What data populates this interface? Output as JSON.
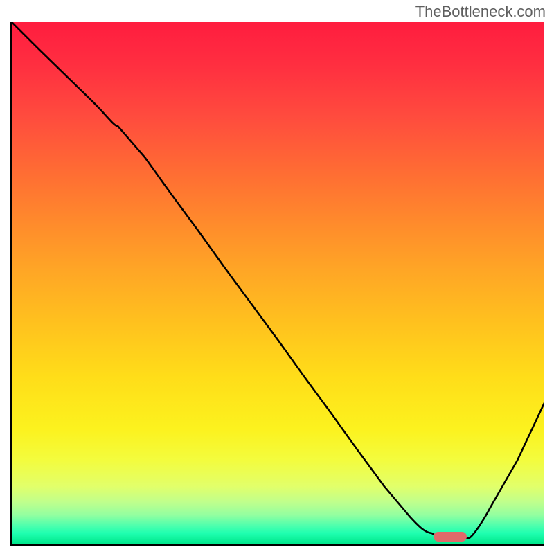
{
  "watermark": "TheBottleneck.com",
  "chart_data": {
    "type": "line",
    "title": "",
    "xlabel": "",
    "ylabel": "",
    "xlim": [
      0,
      100
    ],
    "ylim": [
      0,
      100
    ],
    "x": [
      0,
      5,
      10,
      15,
      20,
      25,
      30,
      35,
      40,
      45,
      50,
      55,
      60,
      65,
      70,
      75,
      79,
      82,
      86,
      90,
      95,
      100
    ],
    "values": [
      100,
      95,
      90,
      85,
      80,
      74,
      67,
      60,
      53,
      46,
      39,
      32,
      25,
      18,
      11,
      5,
      2,
      1,
      1,
      7,
      16,
      27
    ],
    "marker": {
      "x_start": 79,
      "x_end": 86,
      "y": 1
    },
    "grid": false,
    "legend_position": "none"
  },
  "colors": {
    "axis": "#000000",
    "curve": "#000000",
    "marker": "#e06a6a"
  }
}
